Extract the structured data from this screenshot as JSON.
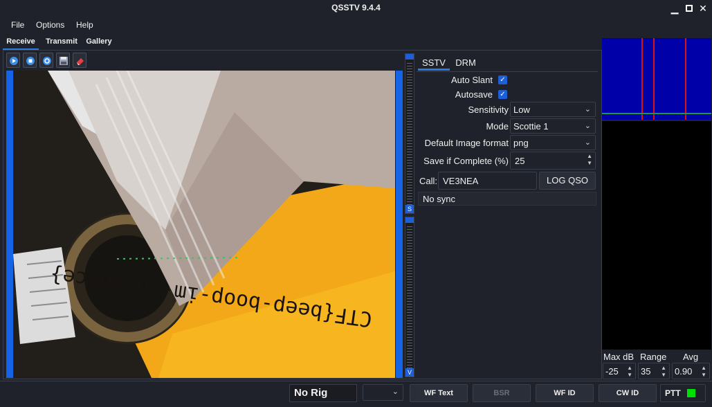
{
  "window": {
    "title": "QSSTV 9.4.4"
  },
  "menu": [
    "File",
    "Options",
    "Help"
  ],
  "main_tabs": [
    "Receive",
    "Transmit",
    "Gallery"
  ],
  "toolbar_icons": [
    "play-icon",
    "stop-icon",
    "refresh-icon",
    "save-icon",
    "eraser-icon"
  ],
  "image": {
    "caption": "CTF{beep-boop-im-in-space}"
  },
  "sliders": {
    "upper_label": "S",
    "lower_label": "V"
  },
  "settings_tabs": [
    "SSTV",
    "DRM"
  ],
  "settings": {
    "auto_slant_label": "Auto Slant",
    "auto_slant_checked": true,
    "autosave_label": "Autosave",
    "autosave_checked": true,
    "sensitivity_label": "Sensitivity",
    "sensitivity_value": "Low",
    "mode_label": "Mode",
    "mode_value": "Scottie 1",
    "default_format_label": "Default Image format",
    "default_format_value": "png",
    "save_if_complete_label": "Save if Complete (%)",
    "save_if_complete_value": "25",
    "call_label": "Call:",
    "call_value": "VE3NEA",
    "log_qso_label": "LOG QSO",
    "sync_status": "No sync"
  },
  "waterfall": {
    "max_db_label": "Max dB",
    "max_db_value": "-25",
    "range_label": "Range",
    "range_value": "35",
    "avg_label": "Avg",
    "avg_value": "0.90"
  },
  "statusbar": {
    "rig": "No Rig",
    "combo_value": "",
    "wf_text": "WF Text",
    "bsr": "BSR",
    "wf_id": "WF ID",
    "cw_id": "CW ID",
    "ptt": "PTT",
    "ptt_color": "#00e000"
  }
}
